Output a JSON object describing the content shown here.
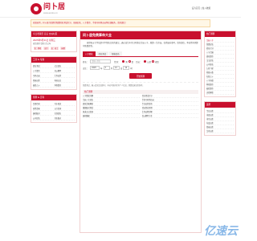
{
  "header": {
    "logo_text": "问卜居",
    "logo_url": "www.wenbu.cn",
    "right_text": "设为首页 | 加入收藏"
  },
  "notice": "欢迎来到，问卜居为您提供免费姓名测试打分、周易起名、八字算命、手机号码测吉凶等在线服务，请勿迷信！",
  "left": {
    "calendar_title": "今日老黄历 宜忌 吉凶时辰",
    "date": "2025年5月21日 星期三",
    "lunar": "农历四月廿四 乙巳年",
    "tags": [
      "宜：祭祀",
      "出行",
      "忌：动土",
      "嫁娶"
    ],
    "tools_title": "工具 & 专题",
    "tools": [
      "姓名测试",
      "宝宝起名",
      "八字算命",
      "周公解梦",
      "号码吉凶",
      "生肖运势",
      "星座运势",
      "黄道吉日",
      "抽签占卜",
      "称骨算命"
    ],
    "more_title": "测算 & 百科",
    "more": [
      "命理百科",
      "风水知识",
      "易经卦象",
      "五行查询",
      "属相配对",
      "在线起名",
      "公司起名",
      "姓名配对"
    ]
  },
  "main": {
    "title": "问卜居免费算命大全",
    "intro": "易经和五行学说是中华传统文化的瑰宝，通过出生年月日时排出生辰八字，推算一生命运，仅供娱乐参考，请勿迷信，本站所有测算均免费提供。",
    "tabs": [
      "八字精批",
      "姓名测试",
      "智能起名"
    ],
    "name_label": "姓名：",
    "name_placeholder": "请输入姓名",
    "gender_label": "性别：",
    "gender_male": "男",
    "gender_female": "女",
    "calendar_label": "历法：",
    "calendar_solar": "公历",
    "calendar_lunar": "农历",
    "birth_label": "出生：",
    "year": "2025",
    "year_unit": "年",
    "month": "5",
    "month_unit": "月",
    "day": "21",
    "day_unit": "日",
    "hour": "10",
    "hour_unit": "时",
    "submit": "开始测算",
    "note": "免费测试，输入真实信息即可，本站不保存任何个人信息，测算结果仅供参考。",
    "section_title": "热门测算",
    "list": [
      "八字精批详解",
      "姓名测试打分",
      "生辰八字起名",
      "手机号码测吉凶",
      "周易卦象解析",
      "今日运势查询",
      "婚姻配对测试",
      "财运事业预测",
      "黄道吉日查询",
      "生肖运程详解",
      "属相婚配",
      "周公解梦大全"
    ]
  },
  "right": {
    "title1": "热门测算",
    "list1": [
      "生辰八字",
      "免费起名",
      "姓名打分",
      "八字合婚",
      "周易算命",
      "宝宝起名",
      "公司取名",
      "九星飞星",
      "紫微斗数",
      "在线占卜",
      "八字排盘",
      "称骨算命",
      "抽签算命",
      "灵签解签"
    ],
    "title2": "运势",
    "list2": [
      "今日运势",
      "本周运势",
      "本月运势",
      "年度运势",
      "星座运势",
      "生肖运势"
    ]
  },
  "watermark": "亿速云"
}
